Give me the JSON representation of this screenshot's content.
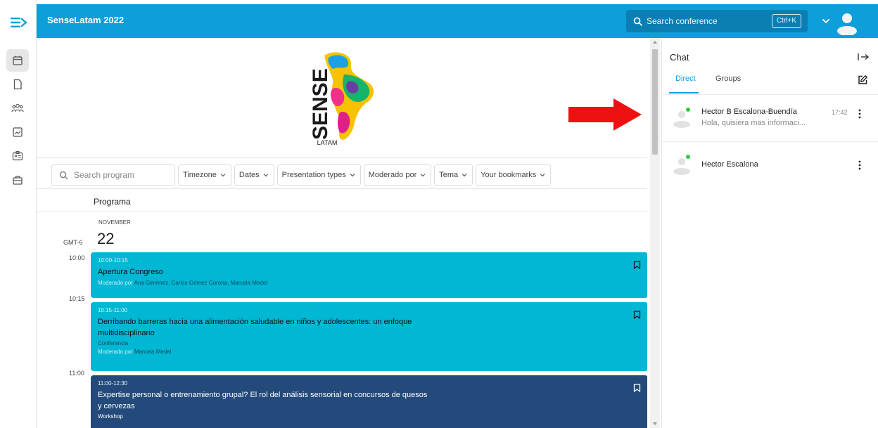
{
  "header": {
    "conference_title": "SenseLatam 2022",
    "search_placeholder": "Search conference",
    "shortcut": "Ctrl+K"
  },
  "left_rail": {
    "items": [
      "menu-icon",
      "calendar-icon",
      "document-icon",
      "people-icon",
      "image-icon",
      "id-card-icon",
      "briefcase-icon"
    ]
  },
  "banner": {
    "logo_word": "SENSE",
    "logo_sub": "LATAM"
  },
  "filters": {
    "search_placeholder": "Search program",
    "chips": [
      "Timezone",
      "Dates",
      "Presentation types",
      "Moderado por",
      "Tema",
      "Your bookmarks"
    ]
  },
  "program": {
    "label": "Programa",
    "month": "NOVEMBER",
    "timezone": "GMT-6",
    "day": "22",
    "time_labels": [
      "10:00",
      "10:15",
      "11:00"
    ],
    "events": [
      {
        "time": "10:00-10:15",
        "title": "Apertura Congreso",
        "type": "",
        "moderated_prefix": "Moderado por",
        "moderators": "Ana Giménez, Carlos Gómez Corona, Marcela Medel"
      },
      {
        "time": "10:15-11:00",
        "title": "Derribando barreras hacia una alimentación saludable en niños y adolescentes: un enfoque multidisciplinario",
        "type": "Conferencia",
        "moderated_prefix": "Moderado por",
        "moderators": "Marcela Medel"
      },
      {
        "time": "11:00-12:30",
        "title": "Expertise personal o entrenamiento grupal? El rol del análisis sensorial en concursos de quesos y cervezas",
        "type": "Workshop",
        "moderated_prefix": "",
        "moderators": ""
      }
    ]
  },
  "chat": {
    "title": "Chat",
    "tabs": [
      "Direct",
      "Groups"
    ],
    "active_tab": "Direct",
    "conversations": [
      {
        "name": "Hector B Escalona-Buendía",
        "preview": "Hola, quisiera mas informaci...",
        "time": "17:42"
      },
      {
        "name": "Hector Escalona",
        "preview": "",
        "time": ""
      }
    ]
  },
  "colors": {
    "brand_blue": "#0e9ed8",
    "event_cyan": "#00b7d4",
    "event_navy": "#234a7b",
    "online_green": "#2ecc40",
    "annotation_red": "#ee1111"
  }
}
